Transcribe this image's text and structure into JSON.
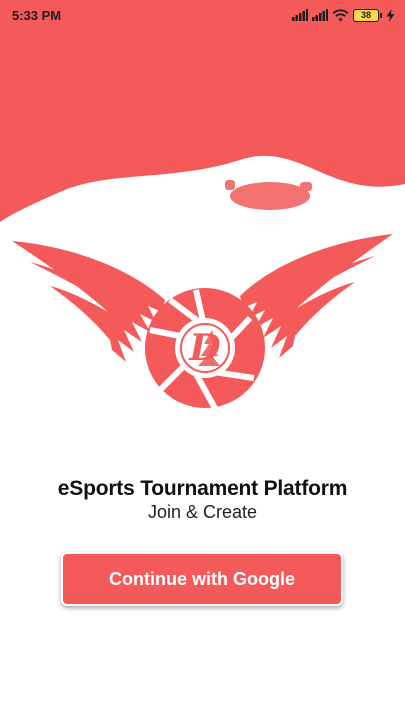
{
  "status_bar": {
    "time": "5:33 PM",
    "battery_level": "38",
    "icons": [
      "signal-icon",
      "signal-icon",
      "wifi-icon",
      "battery-icon",
      "charging-icon"
    ]
  },
  "colors": {
    "brand": "#f45a5a",
    "text_dark": "#111111",
    "background": "#ffffff"
  },
  "logo": {
    "monogram": "D"
  },
  "app": {
    "title": "eSports Tournament Platform",
    "subtitle": "Join & Create"
  },
  "auth": {
    "google_button_label": "Continue with Google"
  }
}
